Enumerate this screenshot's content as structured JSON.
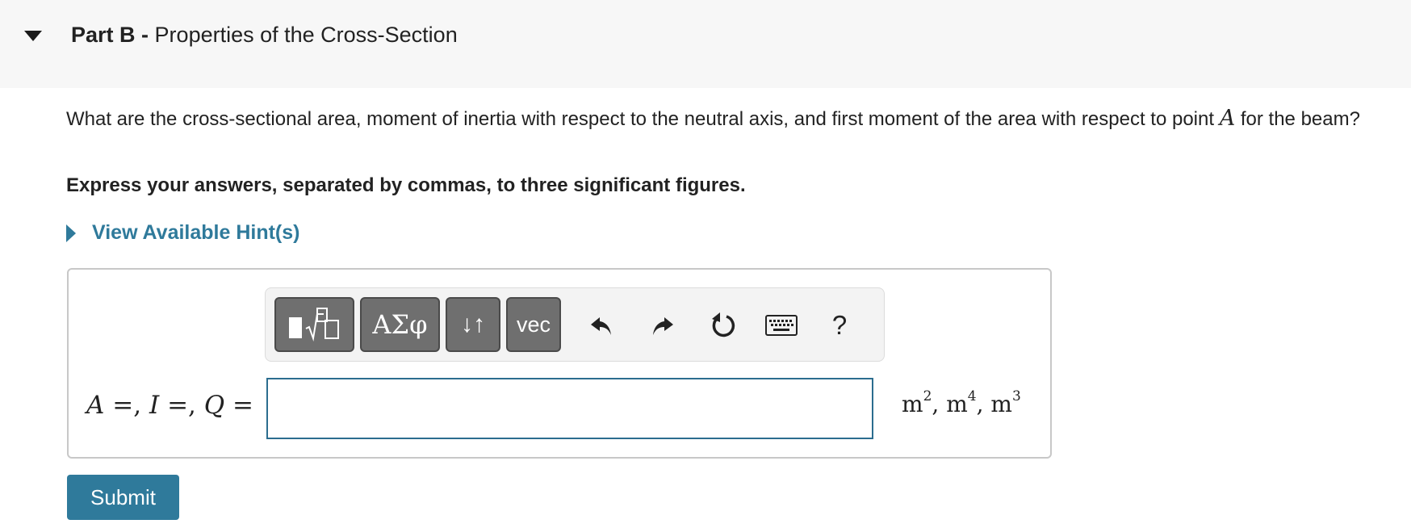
{
  "part": {
    "label": "Part B -",
    "title": "Properties of the Cross-Section"
  },
  "question": {
    "text_before": "What are the cross-sectional area, moment of inertia with respect to the neutral axis, and first moment of the area with respect to point ",
    "point_var": "A",
    "text_after": " for the beam?"
  },
  "instructions": "Express your answers, separated by commas, to three significant figures.",
  "hints": {
    "label": "View Available Hint(s)"
  },
  "toolbar": {
    "greek_label": "ΑΣφ",
    "arrows_label": "↓↑",
    "vec_label": "vec",
    "help_label": "?"
  },
  "answer": {
    "var1": "A",
    "var2": "I",
    "var3": "Q",
    "equals": "=",
    "sep": ",",
    "value": "",
    "units": {
      "u1": "m",
      "e1": "2",
      "u2": "m",
      "e2": "4",
      "u3": "m",
      "e3": "3",
      "sep": ", "
    }
  },
  "submit_label": "Submit",
  "colors": {
    "accent": "#2f7a9b",
    "input_border": "#2c6d8f",
    "header_bg": "#f7f7f7",
    "toolbar_button": "#6f6f6f"
  }
}
